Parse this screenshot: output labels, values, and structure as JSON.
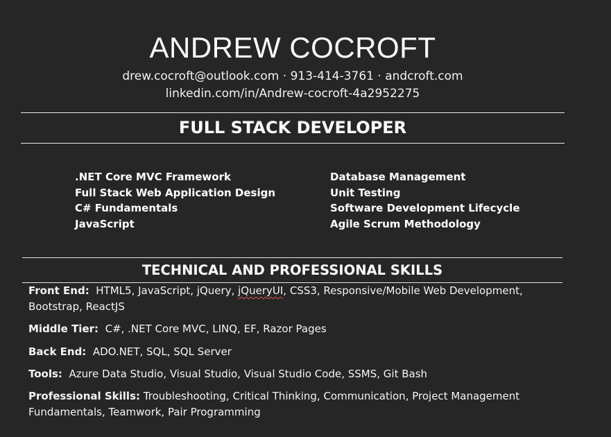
{
  "header": {
    "name": "ANDREW COCROFT",
    "contact_line1": "drew.cocroft@outlook.com · 913-414-3761 · andcroft.com",
    "contact_line2": "linkedin.com/in/Andrew-cocroft-4a2952275"
  },
  "role_title": "FULL STACK DEVELOPER",
  "highlights": {
    "left": [
      ".NET Core MVC Framework",
      "Full Stack Web Application Design",
      "C# Fundamentals",
      "JavaScript"
    ],
    "right": [
      "Database Management",
      "Unit Testing",
      "Software Development Lifecycle",
      "Agile Scrum Methodology"
    ]
  },
  "skills_section": {
    "title": "TECHNICAL AND PROFESSIONAL SKILLS",
    "front_end": {
      "label": "Front End:",
      "text_before": "HTML5, JavaScript, jQuery, ",
      "flagged_word": "jQueryUI",
      "text_after": ", CSS3, Responsive/Mobile Web Development, Bootstrap, ReactJS"
    },
    "middle_tier": {
      "label": "Middle Tier:",
      "text": "C#, .NET Core MVC, LINQ, EF, Razor Pages"
    },
    "back_end": {
      "label": "Back End:",
      "text": "ADO.NET, SQL, SQL Server"
    },
    "tools": {
      "label": "Tools:",
      "text": "Azure Data Studio, Visual Studio, Visual Studio Code, SSMS, Git Bash"
    },
    "professional": {
      "label": "Professional Skills:",
      "text": "Troubleshooting, Critical Thinking, Communication, Project Management Fundamentals, Teamwork, Pair Programming"
    }
  },
  "colors": {
    "background": "#262626",
    "text": "#ffffff",
    "rule": "#e8e8e8",
    "spellcheck": "#d9534f"
  }
}
